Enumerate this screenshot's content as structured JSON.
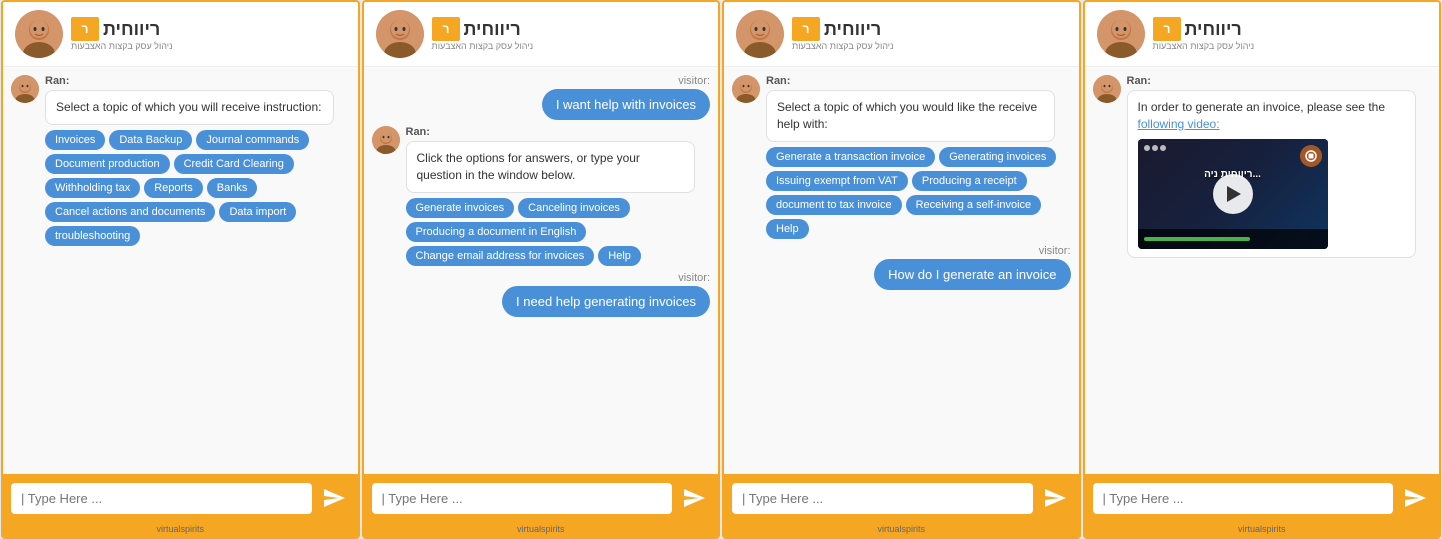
{
  "brand": {
    "name": "ריווחית",
    "sub": "ניהול עסק בקצות האצבעות",
    "icon_char": "ר"
  },
  "windows": [
    {
      "id": "window1",
      "bot_name": "Ran:",
      "messages": [
        {
          "type": "bot",
          "text": "Select a topic of which you will receive instruction:",
          "tags": [
            "Invoices",
            "Data Backup",
            "Journal commands",
            "Document production",
            "Credit Card Clearing",
            "Withholding tax",
            "Reports",
            "Banks",
            "Cancel actions and documents",
            "Data import",
            "troubleshooting"
          ]
        }
      ],
      "visitor_messages": [],
      "input_placeholder": "| Type Here ..."
    },
    {
      "id": "window2",
      "bot_name": "Ran:",
      "visitor_top": "I want help with invoices",
      "messages": [
        {
          "type": "bot",
          "text": "Click the options for answers, or type your question in the window below.",
          "tags": [
            "Generate invoices",
            "Canceling invoices",
            "Producing a document in English",
            "Change email address for invoices",
            "Help"
          ]
        }
      ],
      "visitor_bottom": "I need help generating invoices",
      "input_placeholder": "| Type Here ..."
    },
    {
      "id": "window3",
      "bot_name": "Ran:",
      "messages": [
        {
          "type": "bot",
          "text": "Select a topic of which you would like the receive help with:",
          "tags": [
            "Generate a transaction invoice",
            "Generating invoices",
            "Issuing exempt from VAT",
            "Producing a receipt",
            "document to tax invoice",
            "Receiving a self-invoice",
            "Help"
          ]
        }
      ],
      "visitor_bottom": "How do I generate an invoice",
      "input_placeholder": "| Type Here ..."
    },
    {
      "id": "window4",
      "bot_name": "Ran:",
      "messages": [
        {
          "type": "bot",
          "text": "In order to generate an invoice, please see the following video:",
          "has_video": true
        }
      ],
      "input_placeholder": "| Type Here ..."
    }
  ],
  "footer": {
    "brand": "virtualspirits"
  }
}
